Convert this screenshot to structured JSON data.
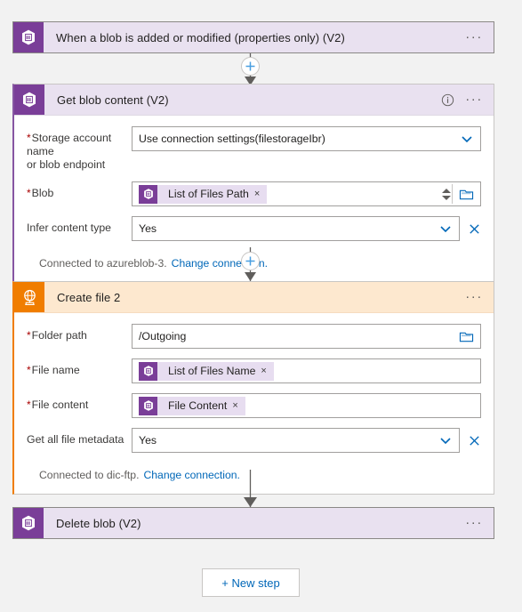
{
  "theme": {
    "canvas_bg": "#f2f2f2",
    "purple_accent": "#7a3e98",
    "purple_header_bg": "#e9e1f0",
    "orange_accent": "#f07d00",
    "orange_header_bg": "#fde8cf",
    "link_blue": "#0067b8",
    "required_red": "#a80000"
  },
  "trigger_card": {
    "title": "When a blob is added or modified (properties only) (V2)",
    "icon": "azure-blob-storage-icon",
    "menu": "···"
  },
  "get_blob_card": {
    "title": "Get blob content (V2)",
    "icon": "azure-blob-storage-icon",
    "info": "i",
    "menu": "···",
    "fields": [
      {
        "label_line1": "Storage account name",
        "label_line2": "or blob endpoint",
        "required": true,
        "type": "dropdown",
        "value": "Use connection settings(filestorageIbr)"
      },
      {
        "label_line1": "Blob",
        "label_line2": "",
        "required": true,
        "type": "token",
        "token": "List of Files Path",
        "token_remove": "×",
        "has_spinner": true,
        "has_folder_picker": true
      },
      {
        "label_line1": "Infer content type",
        "label_line2": "",
        "required": false,
        "type": "dropdown",
        "value": "Yes",
        "has_clear": true
      }
    ],
    "connection_text": "Connected to azureblob-3.",
    "change_connection": "Change connection."
  },
  "create_file_card": {
    "title": "Create file 2",
    "icon": "ftp-icon",
    "menu": "···",
    "fields": [
      {
        "label_line1": "Folder path",
        "label_line2": "",
        "required": true,
        "type": "text",
        "value": "/Outgoing",
        "has_folder_picker": true
      },
      {
        "label_line1": "File name",
        "label_line2": "",
        "required": true,
        "type": "token",
        "token": "List of Files Name",
        "token_remove": "×"
      },
      {
        "label_line1": "File content",
        "label_line2": "",
        "required": true,
        "type": "token",
        "token": "File Content",
        "token_remove": "×"
      },
      {
        "label_line1": "Get all file metadata",
        "label_line2": "",
        "required": false,
        "type": "dropdown",
        "value": "Yes",
        "has_clear": true
      }
    ],
    "connection_text": "Connected to dic-ftp.",
    "change_connection": "Change connection."
  },
  "delete_blob_card": {
    "title": "Delete blob (V2)",
    "icon": "azure-blob-storage-icon",
    "menu": "···"
  },
  "new_step_button": {
    "label": "+ New step"
  },
  "connectors": [
    {
      "has_plus": true,
      "plus": "+"
    },
    {
      "has_plus": true,
      "plus": "+"
    },
    {
      "has_plus": false
    }
  ]
}
